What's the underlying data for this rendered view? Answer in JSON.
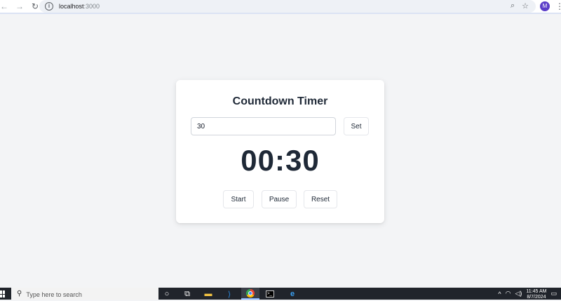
{
  "browser": {
    "back_glyph": "←",
    "forward_glyph": "→",
    "reload_glyph": "↻",
    "info_glyph": "i",
    "url_host": "localhost",
    "url_port": ":3000",
    "zoom_glyph": "⌕",
    "star_glyph": "☆",
    "avatar_letter": "M",
    "menu_glyph": "⋮"
  },
  "timer": {
    "title": "Countdown Timer",
    "input_value": "30",
    "set_label": "Set",
    "display": "00:30",
    "start_label": "Start",
    "pause_label": "Pause",
    "reset_label": "Reset"
  },
  "taskbar": {
    "search_placeholder": "Type here to search",
    "search_glyph": "⚲",
    "cortana_glyph": "○",
    "taskview_glyph": "⧉",
    "explorer_glyph": "▬",
    "vscode_glyph": "⟩",
    "terminal_glyph": ">_",
    "edge_glyph": "e",
    "tray_chevron": "^",
    "network_glyph": "◠",
    "volume_glyph": "◁)",
    "time": "11:45 AM",
    "date": "8/7/2024",
    "notification_glyph": "▭"
  },
  "colors": {
    "page_bg": "#f3f4f6",
    "card_bg": "#ffffff",
    "text_dark": "#1f2937",
    "taskbar_bg": "#20242b",
    "avatar_bg": "#5b3ec8"
  }
}
